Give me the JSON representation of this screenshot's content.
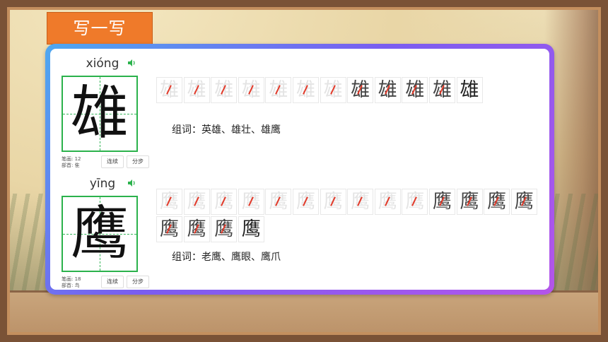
{
  "section_title": "写一写",
  "characters": [
    {
      "pinyin": "xióng",
      "char": "雄",
      "strokes_label": "笔画: 12",
      "radical_label": "部首: 隹",
      "btn_continuous": "连续",
      "btn_step": "分步",
      "stroke_steps": 12,
      "words": "组词：英雄、雄壮、雄鹰"
    },
    {
      "pinyin": "yīng",
      "char": "鹰",
      "strokes_label": "笔画: 18",
      "radical_label": "部首: 鸟",
      "btn_continuous": "连续",
      "btn_step": "分步",
      "stroke_steps": 18,
      "words": "组词：老鹰、鹰眼、鹰爪"
    }
  ],
  "icons": {
    "speaker": "speaker-icon"
  },
  "colors": {
    "tag": "#ef7a2a",
    "grid": "#2bb24c",
    "stroke_mark": "#e23a2a"
  }
}
